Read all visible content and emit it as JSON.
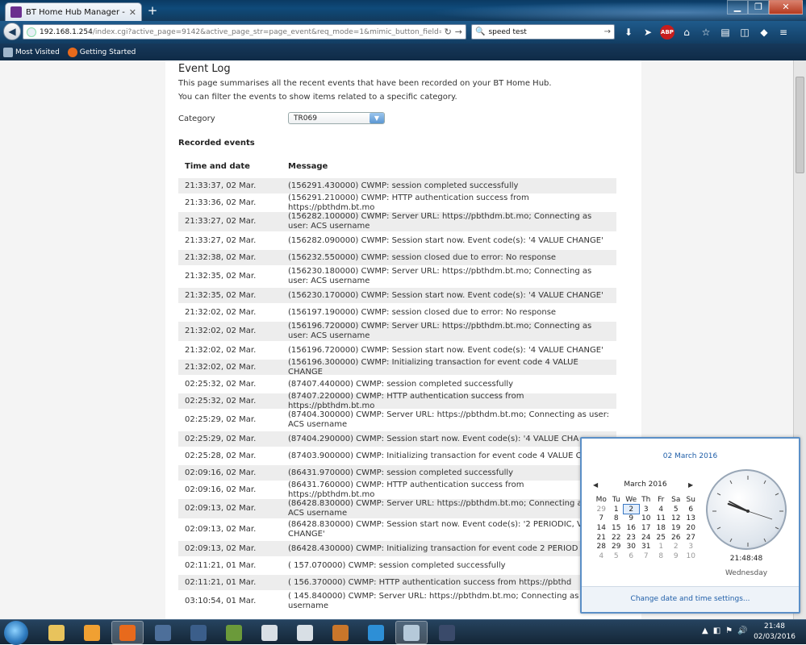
{
  "browser": {
    "tab_title": "BT Home Hub Manager - E...",
    "url_host": "192.168.1.254",
    "url_rest": "/index.cgi?active_page=9142&active_page_str=page_event&req_mode=1&mimic_button_field=onchar",
    "search_value": "speed test",
    "abp_label": "ABP",
    "bookmarks": [
      "Most Visited",
      "Getting Started"
    ]
  },
  "page": {
    "title": "Event Log",
    "intro_line1": "This page summarises all the recent events that have been recorded on your BT Home Hub.",
    "intro_line2": "You can filter the events to show items related to a specific category.",
    "category_label": "Category",
    "category_value": "TR069",
    "recorded_title": "Recorded events",
    "col_time": "Time and date",
    "col_message": "Message",
    "events": [
      {
        "time": "21:33:37, 02 Mar.",
        "message": "(156291.430000) CWMP: session completed successfully"
      },
      {
        "time": "21:33:36, 02 Mar.",
        "message": "(156291.210000) CWMP: HTTP authentication success from https://pbthdm.bt.mo"
      },
      {
        "time": "21:33:27, 02 Mar.",
        "message": "(156282.100000) CWMP: Server URL: https://pbthdm.bt.mo; Connecting as user: ACS username"
      },
      {
        "time": "21:33:27, 02 Mar.",
        "message": "(156282.090000) CWMP: Session start now. Event code(s): '4 VALUE CHANGE'"
      },
      {
        "time": "21:32:38, 02 Mar.",
        "message": "(156232.550000) CWMP: session closed due to error: No response"
      },
      {
        "time": "21:32:35, 02 Mar.",
        "message": "(156230.180000) CWMP: Server URL: https://pbthdm.bt.mo; Connecting as user: ACS username"
      },
      {
        "time": "21:32:35, 02 Mar.",
        "message": "(156230.170000) CWMP: Session start now. Event code(s): '4 VALUE CHANGE'"
      },
      {
        "time": "21:32:02, 02 Mar.",
        "message": "(156197.190000) CWMP: session closed due to error: No response"
      },
      {
        "time": "21:32:02, 02 Mar.",
        "message": "(156196.720000) CWMP: Server URL: https://pbthdm.bt.mo; Connecting as user: ACS username"
      },
      {
        "time": "21:32:02, 02 Mar.",
        "message": "(156196.720000) CWMP: Session start now. Event code(s): '4 VALUE CHANGE'"
      },
      {
        "time": "21:32:02, 02 Mar.",
        "message": "(156196.300000) CWMP: Initializing transaction for event code 4 VALUE CHANGE"
      },
      {
        "time": "02:25:32, 02 Mar.",
        "message": "(87407.440000) CWMP: session completed successfully"
      },
      {
        "time": "02:25:32, 02 Mar.",
        "message": "(87407.220000) CWMP: HTTP authentication success from https://pbthdm.bt.mo"
      },
      {
        "time": "02:25:29, 02 Mar.",
        "message": "(87404.300000) CWMP: Server URL: https://pbthdm.bt.mo; Connecting as user: ACS username"
      },
      {
        "time": "02:25:29, 02 Mar.",
        "message": "(87404.290000) CWMP: Session start now. Event code(s): '4 VALUE CHA"
      },
      {
        "time": "02:25:28, 02 Mar.",
        "message": "(87403.900000) CWMP: Initializing transaction for event code 4 VALUE C"
      },
      {
        "time": "02:09:16, 02 Mar.",
        "message": "(86431.970000) CWMP: session completed successfully"
      },
      {
        "time": "02:09:16, 02 Mar.",
        "message": "(86431.760000) CWMP: HTTP authentication success from https://pbthdm.bt.mo"
      },
      {
        "time": "02:09:13, 02 Mar.",
        "message": "(86428.830000) CWMP: Server URL: https://pbthdm.bt.mo; Connecting as user: ACS username"
      },
      {
        "time": "02:09:13, 02 Mar.",
        "message": "(86428.830000) CWMP: Session start now. Event code(s): '2 PERIODIC, VALUE CHANGE'"
      },
      {
        "time": "02:09:13, 02 Mar.",
        "message": "(86428.430000) CWMP: Initializing transaction for event code 2 PERIOD"
      },
      {
        "time": "02:11:21, 01 Mar.",
        "message": "( 157.070000) CWMP: session completed successfully"
      },
      {
        "time": "02:11:21, 01 Mar.",
        "message": "( 156.370000) CWMP: HTTP authentication success from https://pbthd"
      },
      {
        "time": "03:10:54, 01 Mar.",
        "message": "( 145.840000) CWMP: Server URL: https://pbthdm.bt.mo; Connecting as ACS username"
      }
    ]
  },
  "calendar": {
    "date_title": "02 March 2016",
    "month_label": "March 2016",
    "weekdays": [
      "Mo",
      "Tu",
      "We",
      "Th",
      "Fr",
      "Sa",
      "Su"
    ],
    "days": [
      {
        "d": "29",
        "dim": true
      },
      {
        "d": "1"
      },
      {
        "d": "2",
        "today": true
      },
      {
        "d": "3"
      },
      {
        "d": "4"
      },
      {
        "d": "5"
      },
      {
        "d": "6"
      },
      {
        "d": "7"
      },
      {
        "d": "8"
      },
      {
        "d": "9"
      },
      {
        "d": "10"
      },
      {
        "d": "11"
      },
      {
        "d": "12"
      },
      {
        "d": "13"
      },
      {
        "d": "14"
      },
      {
        "d": "15"
      },
      {
        "d": "16"
      },
      {
        "d": "17"
      },
      {
        "d": "18"
      },
      {
        "d": "19"
      },
      {
        "d": "20"
      },
      {
        "d": "21"
      },
      {
        "d": "22"
      },
      {
        "d": "23"
      },
      {
        "d": "24"
      },
      {
        "d": "25"
      },
      {
        "d": "26"
      },
      {
        "d": "27"
      },
      {
        "d": "28"
      },
      {
        "d": "29"
      },
      {
        "d": "30"
      },
      {
        "d": "31"
      },
      {
        "d": "1",
        "dim": true
      },
      {
        "d": "2",
        "dim": true
      },
      {
        "d": "3",
        "dim": true
      },
      {
        "d": "4",
        "dim": true
      },
      {
        "d": "5",
        "dim": true
      },
      {
        "d": "6",
        "dim": true
      },
      {
        "d": "7",
        "dim": true
      },
      {
        "d": "8",
        "dim": true
      },
      {
        "d": "9",
        "dim": true
      },
      {
        "d": "10",
        "dim": true
      }
    ],
    "clock_time": "21:48:48",
    "clock_day": "Wednesday",
    "footer_link": "Change date and time settings..."
  },
  "taskbar": {
    "clock_time": "21:48",
    "clock_date": "02/03/2016",
    "apps": [
      {
        "name": "explorer-app",
        "color": "#e8c35c"
      },
      {
        "name": "media-player-app",
        "color": "#f0a032"
      },
      {
        "name": "firefox-app",
        "color": "#e86a1c",
        "active": true
      },
      {
        "name": "star-app",
        "color": "#4d6f9a"
      },
      {
        "name": "game-app-1",
        "color": "#3b5e8a"
      },
      {
        "name": "minecraft-app",
        "color": "#6b9a3a"
      },
      {
        "name": "window-app-1",
        "color": "#d8dfe5"
      },
      {
        "name": "window-app-2",
        "color": "#d8dfe5"
      },
      {
        "name": "game-app-2",
        "color": "#c9762a"
      },
      {
        "name": "ie-app",
        "color": "#2d8fd6"
      },
      {
        "name": "network-app",
        "color": "#b5c9d9",
        "active": true
      },
      {
        "name": "game-app-3",
        "color": "#3a4a6a"
      }
    ]
  }
}
